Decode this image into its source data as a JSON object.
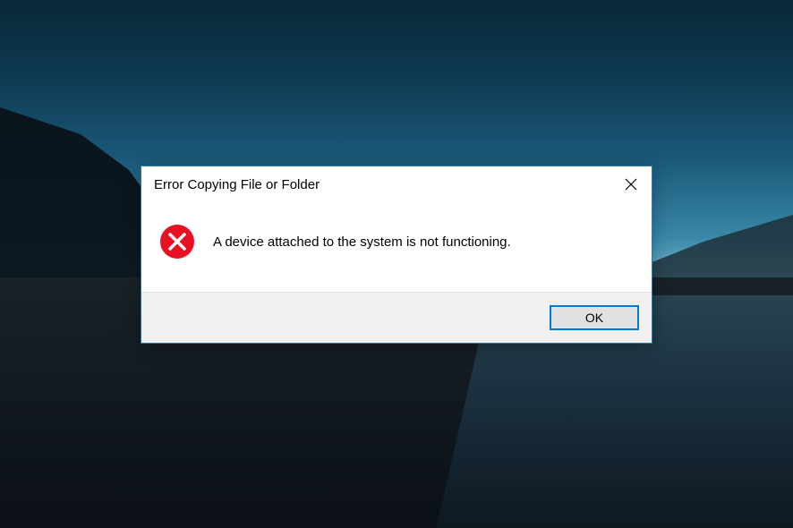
{
  "dialog": {
    "title": "Error Copying File or Folder",
    "message": "A device attached to the system is not functioning.",
    "ok_label": "OK"
  }
}
